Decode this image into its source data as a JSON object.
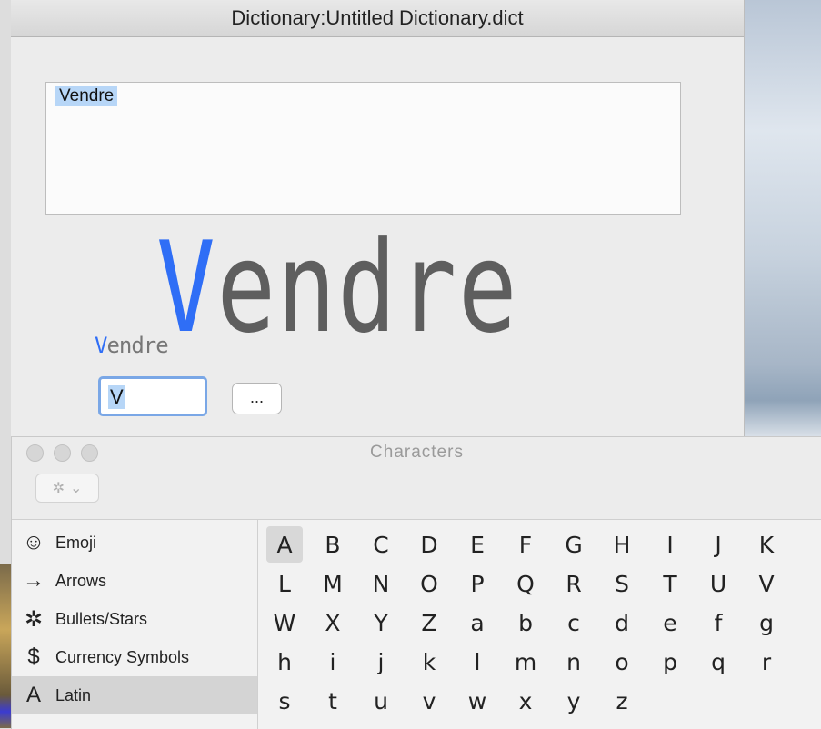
{
  "dictionary_window": {
    "title": "Dictionary:Untitled Dictionary.dict",
    "word_list": [
      "Vendre"
    ],
    "preview_large": {
      "first": "V",
      "rest": "endre"
    },
    "preview_small": {
      "first": "V",
      "rest": "endre"
    },
    "char_input_value": "V",
    "ellipsis_label": "..."
  },
  "characters_window": {
    "title": "Characters",
    "gear_icon": "gear-icon",
    "categories": [
      {
        "icon": "☺",
        "label": "Emoji"
      },
      {
        "icon": "→",
        "label": "Arrows"
      },
      {
        "icon": "✲",
        "label": "Bullets/Stars"
      },
      {
        "icon": "$",
        "label": "Currency Symbols"
      },
      {
        "icon": "A",
        "label": "Latin"
      }
    ],
    "selected_category": "Latin",
    "grid_rows": [
      [
        "A",
        "B",
        "C",
        "D",
        "E",
        "F",
        "G",
        "H",
        "I",
        "J",
        "K"
      ],
      [
        "L",
        "M",
        "N",
        "O",
        "P",
        "Q",
        "R",
        "S",
        "T",
        "U",
        "V"
      ],
      [
        "W",
        "X",
        "Y",
        "Z",
        "a",
        "b",
        "c",
        "d",
        "e",
        "f",
        "g"
      ],
      [
        "h",
        "i",
        "j",
        "k",
        "l",
        "m",
        "n",
        "o",
        "p",
        "q",
        "r"
      ],
      [
        "s",
        "t",
        "u",
        "v",
        "w",
        "x",
        "y",
        "z"
      ]
    ],
    "selected_char": "A"
  }
}
